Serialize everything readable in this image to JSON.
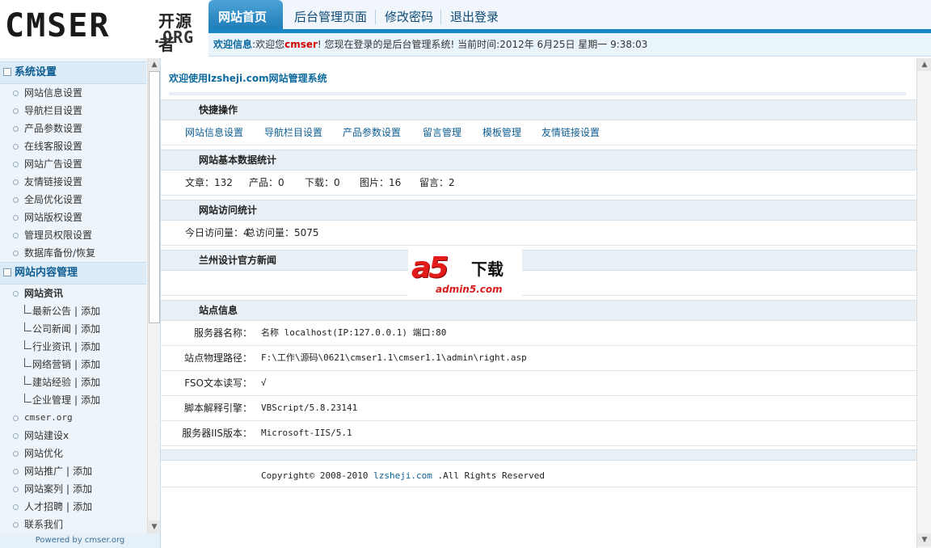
{
  "logo": {
    "brand": "CMSER",
    "org": ".ORG",
    "cn": "开源者"
  },
  "topnav": [
    {
      "label": "网站首页"
    },
    {
      "label": "后台管理页面"
    },
    {
      "label": "修改密码"
    },
    {
      "label": "退出登录"
    }
  ],
  "welcome": {
    "label": "欢迎信息",
    "colon": ":",
    "pre": "欢迎您",
    "user": "cmser",
    "post": "! 您现在登录的是后台管理系统! 当前时间:2012年 6月25日 星期一 9:38:03"
  },
  "sidebar": {
    "section1": "系统设置",
    "items1": [
      "网站信息设置",
      "导航栏目设置",
      "产品参数设置",
      "在线客服设置",
      "网站广告设置",
      "友情链接设置",
      "全局优化设置",
      "网站版权设置",
      "管理员权限设置",
      "数据库备份/恢复"
    ],
    "section2": "网站内容管理",
    "group": "网站资讯",
    "subs": [
      "最新公告",
      "公司新闻",
      "行业资讯",
      "网络营销",
      "建站经验",
      "企业管理"
    ],
    "add": "添加",
    "sep": "|",
    "items2": [
      {
        "label": "cmser.org"
      },
      {
        "label": "网站建设x"
      },
      {
        "label": "网站优化"
      },
      {
        "label": "网站推广",
        "add": "添加"
      },
      {
        "label": "网站案列",
        "add": "添加"
      },
      {
        "label": "人才招聘",
        "add": "添加"
      },
      {
        "label": "联系我们"
      }
    ],
    "footer": "Powered by cmser.org"
  },
  "main": {
    "title": "欢迎使用lzsheji.com网站管理系统",
    "quick_head": "快捷操作",
    "quick_links": [
      "网站信息设置",
      "导航栏目设置",
      "产品参数设置",
      "留言管理",
      "模板管理",
      "友情链接设置"
    ],
    "stats_head": "网站基本数据统计",
    "stats": [
      "文章：132",
      "产品：0",
      "下载：0",
      "图片：16",
      "留言：2"
    ],
    "visits_head": "网站访问统计",
    "visits": [
      "今日访问量：4",
      "总访问量：5075"
    ],
    "news_head": "兰州设计官方新闻",
    "site_head": "站点信息",
    "site_info": [
      {
        "label": "服务器名称：",
        "value": "名称 localhost(IP:127.0.0.1) 端口:80"
      },
      {
        "label": "站点物理路径：",
        "value": "F:\\工作\\源码\\0621\\cmser1.1\\cmser1.1\\admin\\right.asp"
      },
      {
        "label": "FSO文本读写：",
        "value": "√"
      },
      {
        "label": "脚本解释引擎：",
        "value": "VBScript/5.8.23141"
      },
      {
        "label": "服务器IIS版本：",
        "value": "Microsoft-IIS/5.1"
      }
    ],
    "copyright_pre": "Copyright© 2008-2010 ",
    "copyright_link": "lzsheji.com",
    "copyright_post": " .All Rights Reserved"
  },
  "watermark": {
    "a5": "a5",
    "dl": "下载",
    "site": "admin5.com"
  },
  "scroll": {
    "up": "▲",
    "down": "▼"
  }
}
